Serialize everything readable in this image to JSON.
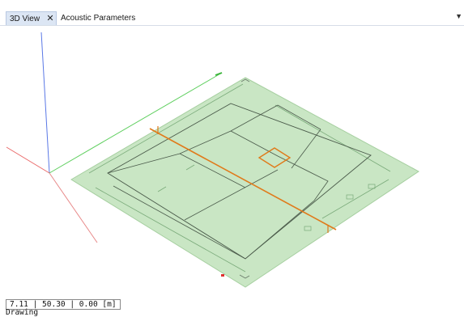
{
  "tabs": [
    {
      "label": "3D View",
      "active": true,
      "close_glyph": "✕"
    },
    {
      "label": "Acoustic Parameters",
      "active": false
    }
  ],
  "tab_menu_icon": "chevron-down-icon",
  "status": {
    "coordinates": "7.11 | 50.30 | 0.00 [m]",
    "mode": "Drawing"
  },
  "colors": {
    "active_tab_bg": "#dce6f4",
    "floor_fill": "#c9e6c4",
    "highlight_orange": "#e07a1a",
    "axis_x": "#e03030",
    "axis_y": "#3cb43c",
    "axis_z": "#3060e0"
  }
}
